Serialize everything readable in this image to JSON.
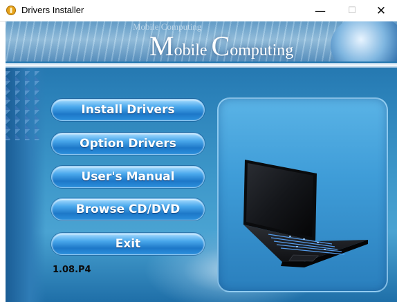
{
  "window": {
    "title": "Drivers Installer",
    "minimize_glyph": "—",
    "maximize_glyph": "☐",
    "close_glyph": "✕"
  },
  "banner": {
    "small_text": "Mobile Computing",
    "big_cap_1": "M",
    "big_rest_1": "obile ",
    "big_cap_2": "C",
    "big_rest_2": "omputing"
  },
  "menu": {
    "items": [
      {
        "label": "Install Drivers"
      },
      {
        "label": "Option Drivers"
      },
      {
        "label": "User's Manual"
      },
      {
        "label": "Browse CD/DVD"
      },
      {
        "label": "Exit"
      }
    ]
  },
  "version": "1.08.P4",
  "icons": {
    "app": "app-coin-icon",
    "product": "laptop-image"
  },
  "colors": {
    "background": "#2a80b8",
    "button_top": "#a7dcff",
    "button_bottom": "#1d78c8",
    "button_text": "#ffffff",
    "keyboard_backlight": "#5aa8ff"
  }
}
